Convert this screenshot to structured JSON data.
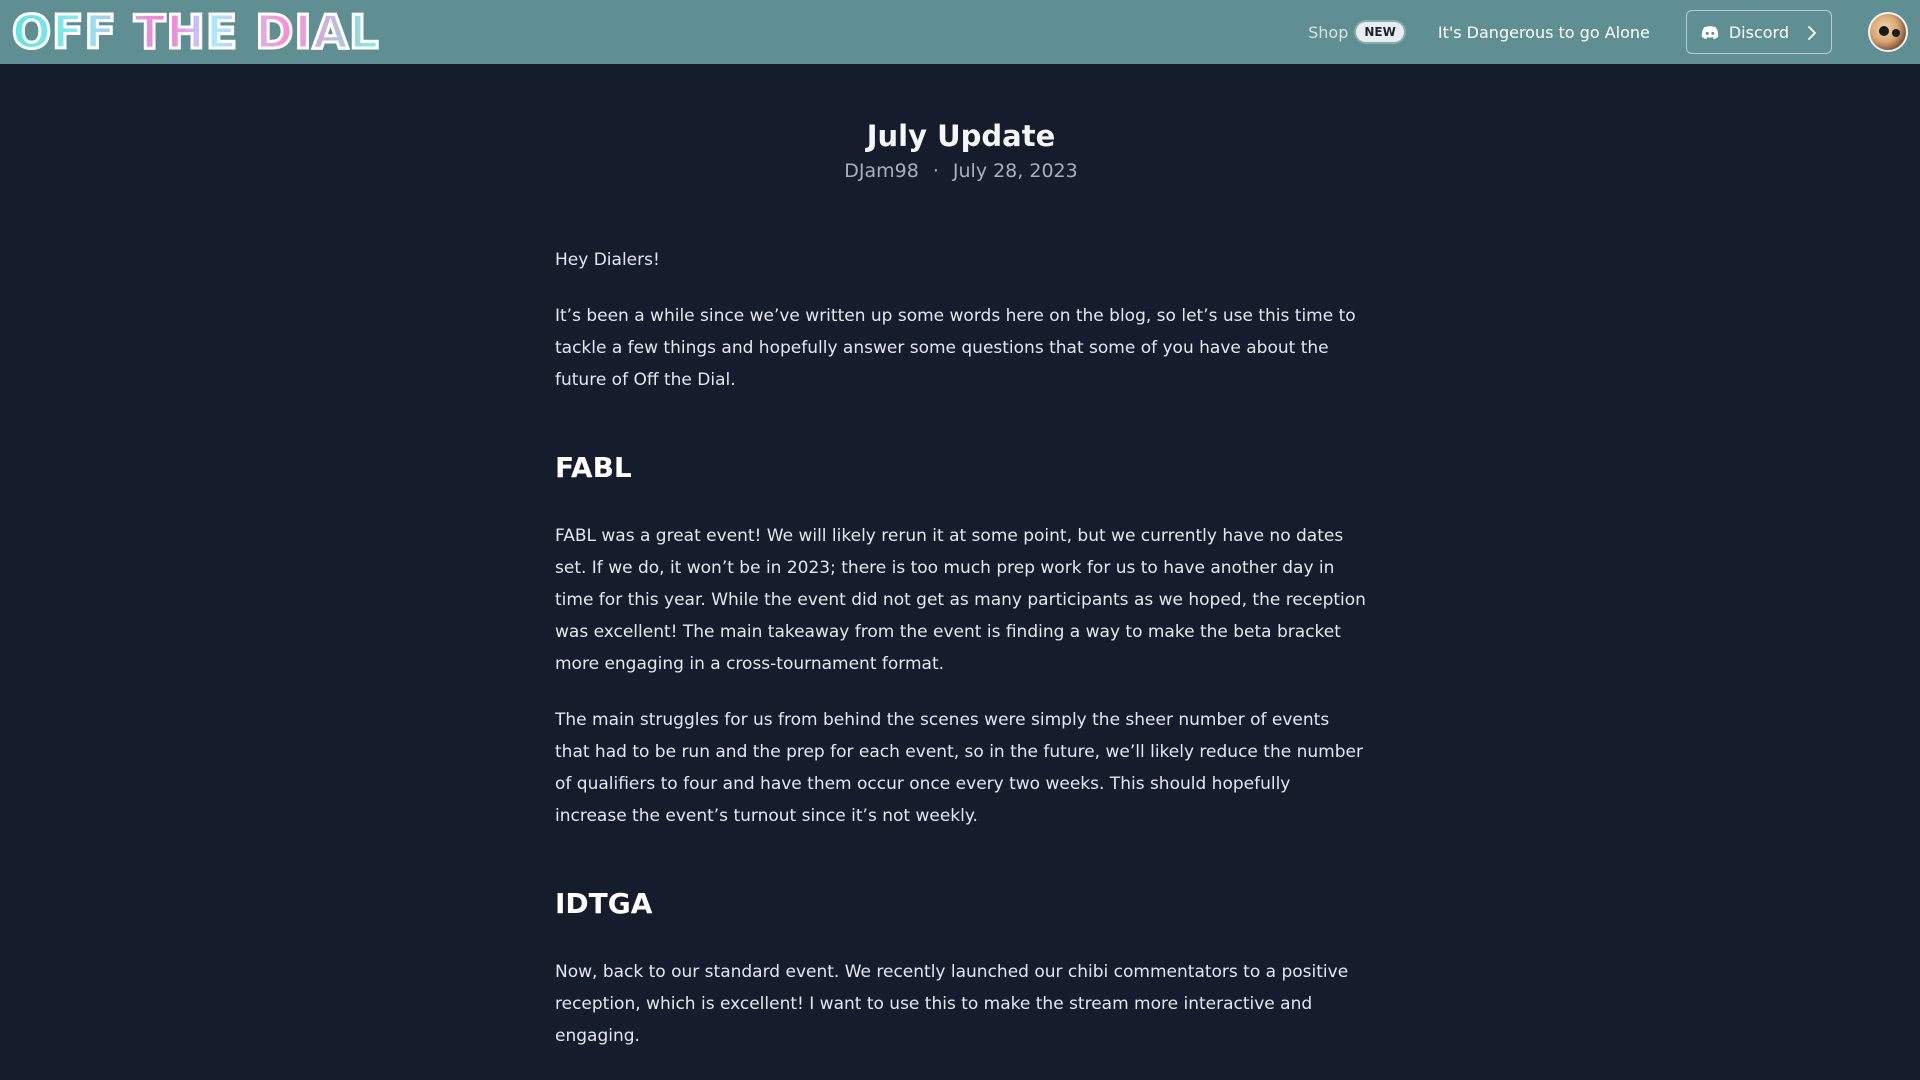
{
  "header": {
    "logo_text": "OFF THE DIAL",
    "nav": {
      "shop_label": "Shop",
      "shop_badge": "NEW",
      "idtga_label": "It's Dangerous to go Alone",
      "discord_label": "Discord"
    }
  },
  "post": {
    "title": "July Update",
    "author": "DJam98",
    "separator": "·",
    "date": "July 28, 2023",
    "paragraphs": [
      "Hey Dialers!",
      "It’s been a while since we’ve written up some words here on the blog, so let’s use this time to tackle a few things and hopefully answer some questions that some of you have about the future of Off the Dial."
    ],
    "sections": [
      {
        "heading": "FABL",
        "paragraphs": [
          "FABL was a great event! We will likely rerun it at some point, but we currently have no dates set. If we do, it won’t be in 2023; there is too much prep work for us to have another day in time for this year. While the event did not get as many participants as we hoped, the reception was excellent! The main takeaway from the event is finding a way to make the beta bracket more engaging in a cross-tournament format.",
          "The main struggles for us from behind the scenes were simply the sheer number of events that had to be run and the prep for each event, so in the future, we’ll likely reduce the number of qualifiers to four and have them occur once every two weeks. This should hopefully increase the event’s turnout since it’s not weekly."
        ]
      },
      {
        "heading": "IDTGA",
        "paragraphs": [
          "Now, back to our standard event. We recently launched our chibi commentators to a positive reception, which is excellent! I want to use this to make the stream more interactive and engaging."
        ]
      }
    ]
  },
  "colors": {
    "header_bg": "#5f8f93",
    "page_bg": "#151c2b",
    "text": "#e3e7ee",
    "meta_text": "#a7afbd"
  }
}
